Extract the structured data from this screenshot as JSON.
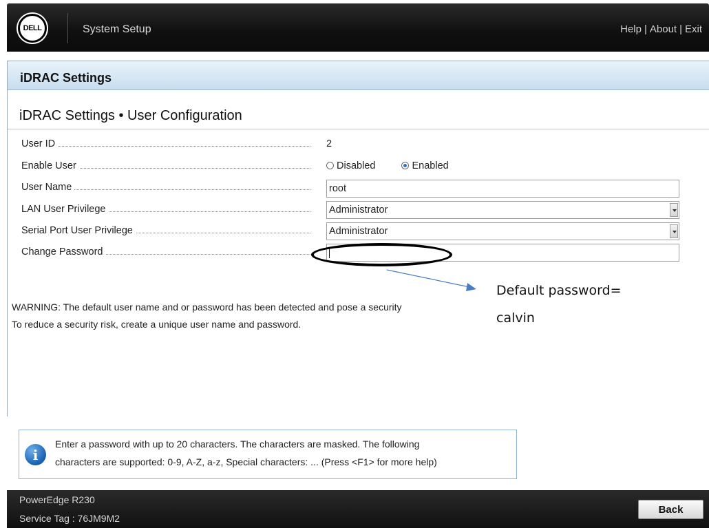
{
  "header": {
    "logo_text": "DELL",
    "title": "System Setup",
    "links": [
      "Help",
      "About",
      "Exit"
    ],
    "separator": "|"
  },
  "section": {
    "title": "iDRAC Settings",
    "subtitle": "iDRAC Settings • User Configuration"
  },
  "form": {
    "user_id": {
      "label": "User ID",
      "value": "2"
    },
    "enable_user": {
      "label": "Enable User",
      "options": [
        "Disabled",
        "Enabled"
      ],
      "selected": "Enabled"
    },
    "user_name": {
      "label": "User Name",
      "value": "root"
    },
    "lan_privilege": {
      "label": "LAN User Privilege",
      "value": "Administrator"
    },
    "serial_privilege": {
      "label": "Serial Port User Privilege",
      "value": "Administrator"
    },
    "change_password": {
      "label": "Change Password",
      "value": ""
    }
  },
  "warning": {
    "line1": "WARNING: The default user name and or password has been detected and pose a security",
    "line2": "To reduce a security risk, create a unique user name and password."
  },
  "annotation": {
    "line1": "Default password=",
    "line2": "calvin"
  },
  "info": {
    "line1": "Enter a password with up to 20 characters. The characters are masked. The following",
    "line2": "characters are supported: 0-9, A-Z, a-z, Special characters: ... (Press <F1> for more help)",
    "icon": "info-icon"
  },
  "footer": {
    "model": "PowerEdge R230",
    "service_tag": "Service Tag : 76JM9M2",
    "back_label": "Back"
  },
  "colors": {
    "header_bg": "#111111",
    "section_bar": "#c7ddef",
    "radio_selected": "#2f6fc7",
    "info_icon": "#1a5fae"
  }
}
